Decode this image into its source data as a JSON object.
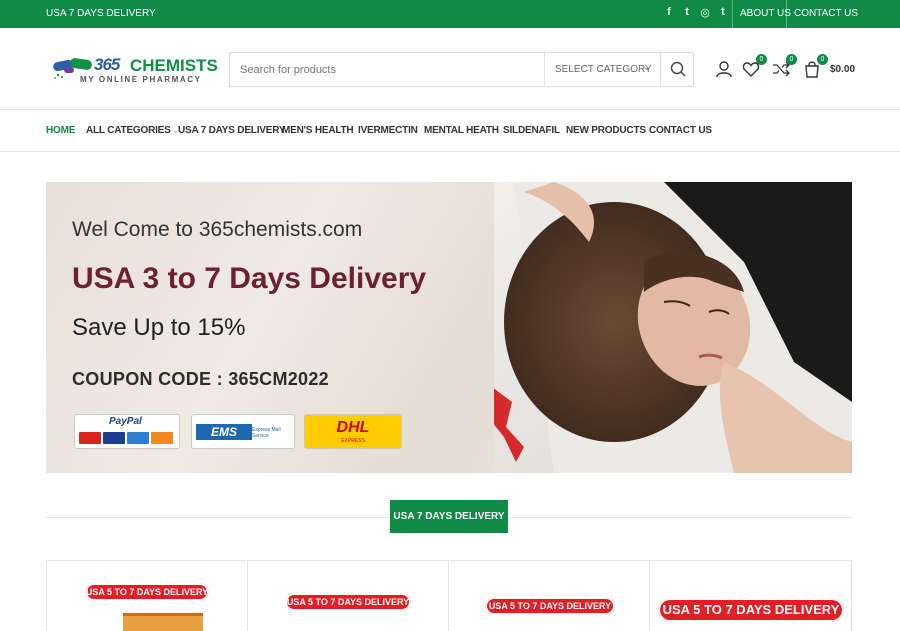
{
  "topbar": {
    "promo": "USA 7 DAYS DELIVERY",
    "social_icons": [
      "facebook-icon",
      "twitter-icon",
      "instagram-icon",
      "tumblr-icon"
    ],
    "social_glyphs": [
      "f",
      "t",
      "◎",
      "t"
    ],
    "links": [
      "ABOUT US",
      "CONTACT US"
    ]
  },
  "logo": {
    "number": "365",
    "name": "CHEMISTS",
    "tagline": "MY ONLINE PHARMACY"
  },
  "search": {
    "placeholder": "Search for products",
    "category": "SELECT CATEGORY"
  },
  "header_icons": {
    "wishlist_count": "0",
    "compare_count": "0",
    "cart_count": "0",
    "cart_total": "$0.00"
  },
  "nav": {
    "items": [
      "HOME",
      "ALL CATEGORIES",
      "USA 7 DAYS DELIVERY",
      "MEN'S HEALTH",
      "IVERMECTIN",
      "MENTAL HEATH",
      "SILDENAFIL",
      "NEW PRODUCTS",
      "CONTACT US"
    ],
    "active": "HOME"
  },
  "banner": {
    "welcome": "Wel Come to 365chemists.com",
    "headline": "USA 3 to 7 Days Delivery",
    "save": "Save Up to 15%",
    "coupon": "COUPON CODE : 365CM2022",
    "paypal": "PayPal",
    "ems": "EMS",
    "ems_text": "Express Mail Service",
    "dhl": "DHL",
    "dhl_text": "EXPRESS"
  },
  "section": {
    "title": "USA 7 DAYS DELIVERY"
  },
  "products": [
    {
      "badge": "USA 5 TO 7 DAYS DELIVERY"
    },
    {
      "badge": "USA 5 TO 7 DAYS DELIVERY"
    },
    {
      "badge": "USA 5 TO 7 DAYS DELIVERY"
    },
    {
      "badge": "USA 5 TO 7 DAYS DELIVERY"
    }
  ],
  "colors": {
    "brand_green": "#108a47",
    "headline_maroon": "#6e1f30",
    "badge_red": "#e31e24"
  }
}
